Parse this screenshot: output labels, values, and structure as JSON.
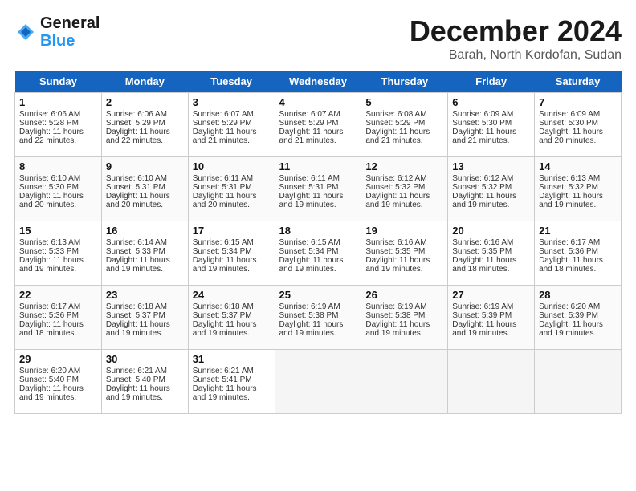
{
  "header": {
    "logo_general": "General",
    "logo_blue": "Blue",
    "month_title": "December 2024",
    "location": "Barah, North Kordofan, Sudan"
  },
  "weekdays": [
    "Sunday",
    "Monday",
    "Tuesday",
    "Wednesday",
    "Thursday",
    "Friday",
    "Saturday"
  ],
  "weeks": [
    [
      {
        "day": "1",
        "lines": [
          "Sunrise: 6:06 AM",
          "Sunset: 5:28 PM",
          "Daylight: 11 hours",
          "and 22 minutes."
        ]
      },
      {
        "day": "2",
        "lines": [
          "Sunrise: 6:06 AM",
          "Sunset: 5:29 PM",
          "Daylight: 11 hours",
          "and 22 minutes."
        ]
      },
      {
        "day": "3",
        "lines": [
          "Sunrise: 6:07 AM",
          "Sunset: 5:29 PM",
          "Daylight: 11 hours",
          "and 21 minutes."
        ]
      },
      {
        "day": "4",
        "lines": [
          "Sunrise: 6:07 AM",
          "Sunset: 5:29 PM",
          "Daylight: 11 hours",
          "and 21 minutes."
        ]
      },
      {
        "day": "5",
        "lines": [
          "Sunrise: 6:08 AM",
          "Sunset: 5:29 PM",
          "Daylight: 11 hours",
          "and 21 minutes."
        ]
      },
      {
        "day": "6",
        "lines": [
          "Sunrise: 6:09 AM",
          "Sunset: 5:30 PM",
          "Daylight: 11 hours",
          "and 21 minutes."
        ]
      },
      {
        "day": "7",
        "lines": [
          "Sunrise: 6:09 AM",
          "Sunset: 5:30 PM",
          "Daylight: 11 hours",
          "and 20 minutes."
        ]
      }
    ],
    [
      {
        "day": "8",
        "lines": [
          "Sunrise: 6:10 AM",
          "Sunset: 5:30 PM",
          "Daylight: 11 hours",
          "and 20 minutes."
        ]
      },
      {
        "day": "9",
        "lines": [
          "Sunrise: 6:10 AM",
          "Sunset: 5:31 PM",
          "Daylight: 11 hours",
          "and 20 minutes."
        ]
      },
      {
        "day": "10",
        "lines": [
          "Sunrise: 6:11 AM",
          "Sunset: 5:31 PM",
          "Daylight: 11 hours",
          "and 20 minutes."
        ]
      },
      {
        "day": "11",
        "lines": [
          "Sunrise: 6:11 AM",
          "Sunset: 5:31 PM",
          "Daylight: 11 hours",
          "and 19 minutes."
        ]
      },
      {
        "day": "12",
        "lines": [
          "Sunrise: 6:12 AM",
          "Sunset: 5:32 PM",
          "Daylight: 11 hours",
          "and 19 minutes."
        ]
      },
      {
        "day": "13",
        "lines": [
          "Sunrise: 6:12 AM",
          "Sunset: 5:32 PM",
          "Daylight: 11 hours",
          "and 19 minutes."
        ]
      },
      {
        "day": "14",
        "lines": [
          "Sunrise: 6:13 AM",
          "Sunset: 5:32 PM",
          "Daylight: 11 hours",
          "and 19 minutes."
        ]
      }
    ],
    [
      {
        "day": "15",
        "lines": [
          "Sunrise: 6:13 AM",
          "Sunset: 5:33 PM",
          "Daylight: 11 hours",
          "and 19 minutes."
        ]
      },
      {
        "day": "16",
        "lines": [
          "Sunrise: 6:14 AM",
          "Sunset: 5:33 PM",
          "Daylight: 11 hours",
          "and 19 minutes."
        ]
      },
      {
        "day": "17",
        "lines": [
          "Sunrise: 6:15 AM",
          "Sunset: 5:34 PM",
          "Daylight: 11 hours",
          "and 19 minutes."
        ]
      },
      {
        "day": "18",
        "lines": [
          "Sunrise: 6:15 AM",
          "Sunset: 5:34 PM",
          "Daylight: 11 hours",
          "and 19 minutes."
        ]
      },
      {
        "day": "19",
        "lines": [
          "Sunrise: 6:16 AM",
          "Sunset: 5:35 PM",
          "Daylight: 11 hours",
          "and 19 minutes."
        ]
      },
      {
        "day": "20",
        "lines": [
          "Sunrise: 6:16 AM",
          "Sunset: 5:35 PM",
          "Daylight: 11 hours",
          "and 18 minutes."
        ]
      },
      {
        "day": "21",
        "lines": [
          "Sunrise: 6:17 AM",
          "Sunset: 5:36 PM",
          "Daylight: 11 hours",
          "and 18 minutes."
        ]
      }
    ],
    [
      {
        "day": "22",
        "lines": [
          "Sunrise: 6:17 AM",
          "Sunset: 5:36 PM",
          "Daylight: 11 hours",
          "and 18 minutes."
        ]
      },
      {
        "day": "23",
        "lines": [
          "Sunrise: 6:18 AM",
          "Sunset: 5:37 PM",
          "Daylight: 11 hours",
          "and 19 minutes."
        ]
      },
      {
        "day": "24",
        "lines": [
          "Sunrise: 6:18 AM",
          "Sunset: 5:37 PM",
          "Daylight: 11 hours",
          "and 19 minutes."
        ]
      },
      {
        "day": "25",
        "lines": [
          "Sunrise: 6:19 AM",
          "Sunset: 5:38 PM",
          "Daylight: 11 hours",
          "and 19 minutes."
        ]
      },
      {
        "day": "26",
        "lines": [
          "Sunrise: 6:19 AM",
          "Sunset: 5:38 PM",
          "Daylight: 11 hours",
          "and 19 minutes."
        ]
      },
      {
        "day": "27",
        "lines": [
          "Sunrise: 6:19 AM",
          "Sunset: 5:39 PM",
          "Daylight: 11 hours",
          "and 19 minutes."
        ]
      },
      {
        "day": "28",
        "lines": [
          "Sunrise: 6:20 AM",
          "Sunset: 5:39 PM",
          "Daylight: 11 hours",
          "and 19 minutes."
        ]
      }
    ],
    [
      {
        "day": "29",
        "lines": [
          "Sunrise: 6:20 AM",
          "Sunset: 5:40 PM",
          "Daylight: 11 hours",
          "and 19 minutes."
        ]
      },
      {
        "day": "30",
        "lines": [
          "Sunrise: 6:21 AM",
          "Sunset: 5:40 PM",
          "Daylight: 11 hours",
          "and 19 minutes."
        ]
      },
      {
        "day": "31",
        "lines": [
          "Sunrise: 6:21 AM",
          "Sunset: 5:41 PM",
          "Daylight: 11 hours",
          "and 19 minutes."
        ]
      },
      null,
      null,
      null,
      null
    ]
  ]
}
